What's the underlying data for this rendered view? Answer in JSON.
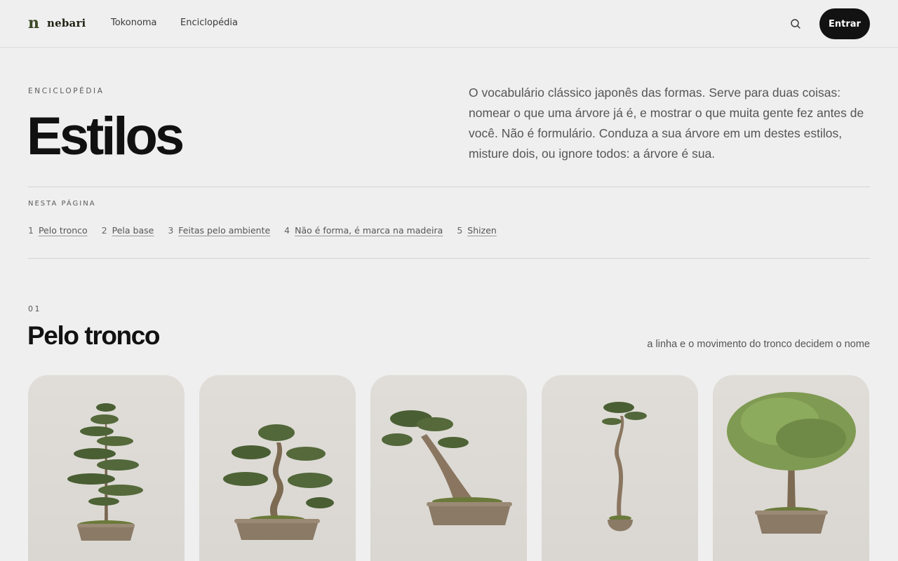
{
  "header": {
    "brand_mark": "n",
    "brand_name": "nebari",
    "nav": [
      "Tokonoma",
      "Enciclopédia"
    ],
    "search_icon": "search-icon",
    "login_label": "Entrar"
  },
  "hero": {
    "eyebrow": "ENCICLOPÉDIA",
    "title": "Estilos",
    "description": "O vocabulário clássico japonês das formas. Serve para duas coisas: nomear o que uma árvore já é, e mostrar o que muita gente fez antes de você. Não é formulário. Conduza a sua árvore em um destes estilos, misture dois, ou ignore todos: a árvore é sua."
  },
  "toc": {
    "label": "NESTA PÁGINA",
    "items": [
      {
        "num": "1",
        "label": "Pelo tronco"
      },
      {
        "num": "2",
        "label": "Pela base"
      },
      {
        "num": "3",
        "label": "Feitas pelo ambiente"
      },
      {
        "num": "4",
        "label": "Não é forma, é marca na madeira"
      },
      {
        "num": "5",
        "label": "Shizen"
      }
    ]
  },
  "section": {
    "number": "01",
    "title": "Pelo tronco",
    "subtitle": "a linha e o movimento do tronco decidem o nome"
  },
  "cards": [
    {
      "name": "formal-upright-bonsai-image"
    },
    {
      "name": "informal-upright-bonsai-image"
    },
    {
      "name": "slanting-bonsai-image"
    },
    {
      "name": "literati-bonsai-image"
    },
    {
      "name": "broom-bonsai-image"
    }
  ],
  "colors": {
    "background": "#efefef",
    "accent": "#3c4a26",
    "button": "#121212"
  }
}
